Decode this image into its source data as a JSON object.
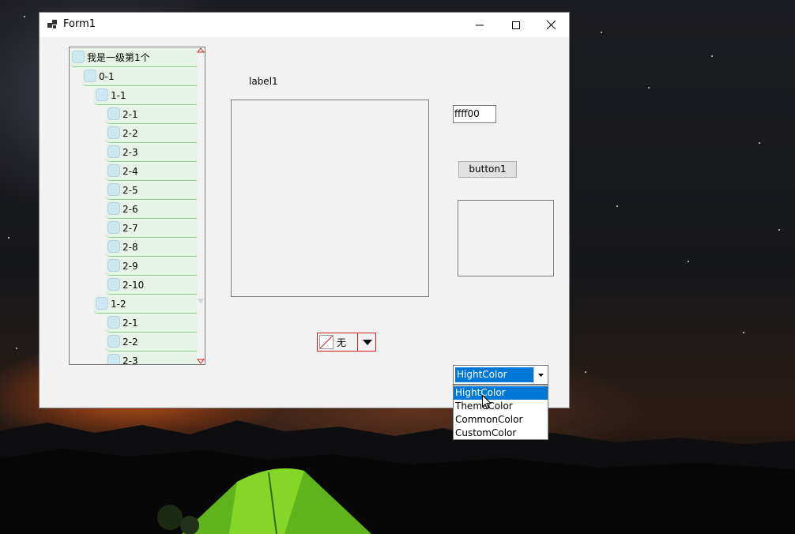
{
  "window": {
    "title": "Form1"
  },
  "tree": {
    "nodes": [
      {
        "label": "我是一级第1个",
        "level": 0
      },
      {
        "label": "0-1",
        "level": 1
      },
      {
        "label": "1-1",
        "level": 2
      },
      {
        "label": "2-1",
        "level": 3
      },
      {
        "label": "2-2",
        "level": 3
      },
      {
        "label": "2-3",
        "level": 3
      },
      {
        "label": "2-4",
        "level": 3
      },
      {
        "label": "2-5",
        "level": 3
      },
      {
        "label": "2-6",
        "level": 3
      },
      {
        "label": "2-7",
        "level": 3
      },
      {
        "label": "2-8",
        "level": 3
      },
      {
        "label": "2-9",
        "level": 3
      },
      {
        "label": "2-10",
        "level": 3
      },
      {
        "label": "1-2",
        "level": 2
      },
      {
        "label": "2-1",
        "level": 3
      },
      {
        "label": "2-2",
        "level": 3
      },
      {
        "label": "2-3",
        "level": 3
      }
    ]
  },
  "label1": "label1",
  "color_textbox": "ffff00",
  "button1": "button1",
  "color_picker": {
    "text": "无"
  },
  "combo": {
    "selected": "HightColor",
    "options": [
      "HightColor",
      "ThemeColor",
      "CommonColor",
      "CustomColor"
    ]
  },
  "colors": {
    "accent": "#0078d7",
    "tree_node_bg": "#e8f3e8",
    "tree_node_border": "#8fd18f",
    "picker_border": "#d21e1e"
  }
}
